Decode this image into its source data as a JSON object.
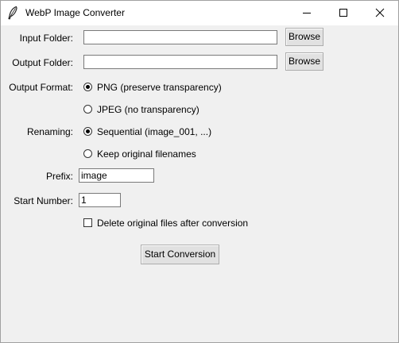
{
  "window": {
    "title": "WebP Image Converter"
  },
  "form": {
    "input_folder": {
      "label": "Input Folder:",
      "value": "",
      "browse_label": "Browse"
    },
    "output_folder": {
      "label": "Output Folder:",
      "value": "",
      "browse_label": "Browse"
    },
    "output_format": {
      "label": "Output Format:",
      "options": [
        {
          "label": "PNG (preserve transparency)",
          "selected": true
        },
        {
          "label": "JPEG (no transparency)",
          "selected": false
        }
      ]
    },
    "renaming": {
      "label": "Renaming:",
      "options": [
        {
          "label": "Sequential (image_001, ...)",
          "selected": true
        },
        {
          "label": "Keep original filenames",
          "selected": false
        }
      ]
    },
    "prefix": {
      "label": "Prefix:",
      "value": "image"
    },
    "start_number": {
      "label": "Start Number:",
      "value": "1"
    },
    "delete_originals": {
      "label": "Delete original files after conversion",
      "checked": false
    },
    "start_button_label": "Start Conversion"
  }
}
